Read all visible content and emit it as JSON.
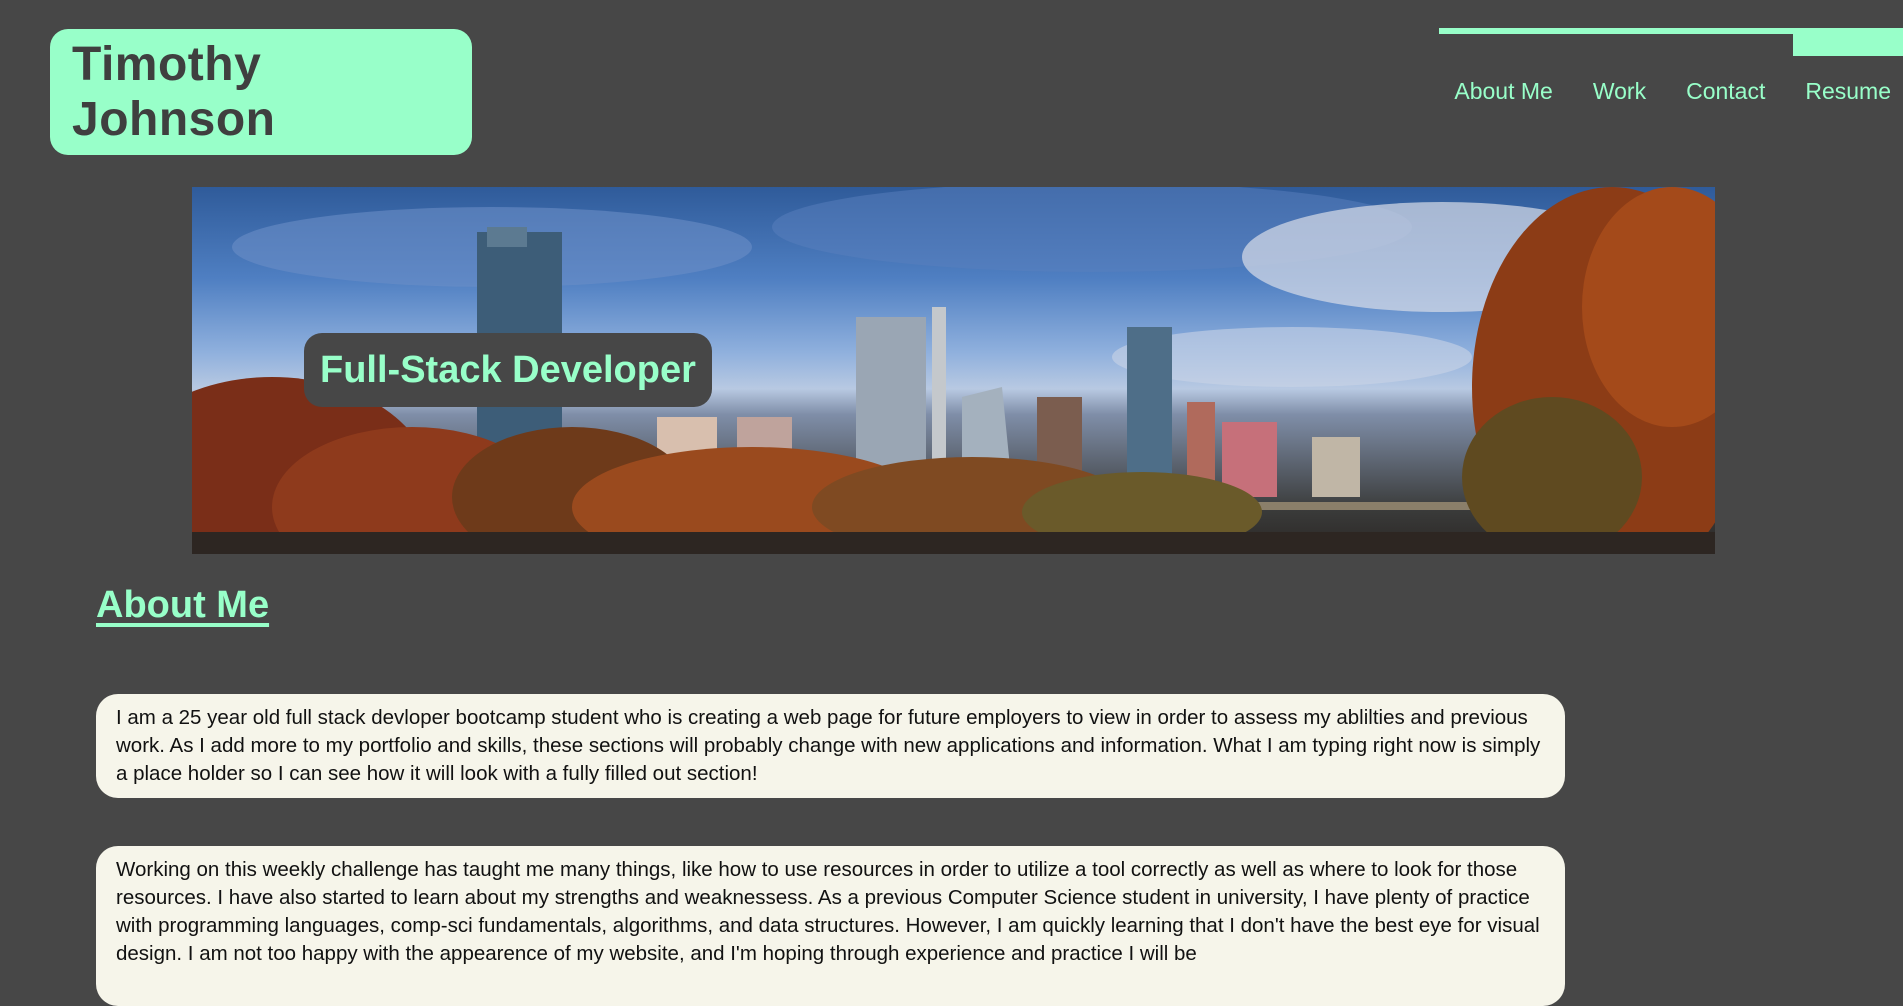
{
  "header": {
    "site_title": "Timothy Johnson"
  },
  "nav": {
    "items": [
      {
        "label": "About Me"
      },
      {
        "label": "Work"
      },
      {
        "label": "Contact"
      },
      {
        "label": "Resume"
      }
    ]
  },
  "hero": {
    "label": "Full-Stack Developer"
  },
  "about": {
    "heading": "About Me",
    "paragraphs": [
      "I am a 25 year old full stack devloper bootcamp student who is creating a web page for future employers to view in order to assess my ablilties and previous work. As I add more to my portfolio and skills, these sections will probably change with new applications and information. What I am typing right now is simply a place holder so I can see how it will look with a fully filled out section!",
      "Working on this weekly challenge has taught me many things, like how to use resources in order to utilize a tool correctly as well as where to look for those resources. I have also started to learn about my strengths and weaknessess. As a previous Computer Science student in university, I have plenty of practice with programming languages, comp-sci fundamentals, algorithms, and data structures. However, I am quickly learning that I don't have the best eye for visual design. I am not too happy with the appearence of my website, and I'm hoping through experience and practice I will be"
    ]
  },
  "colors": {
    "background": "#474747",
    "accent": "#98ffc9",
    "card": "#f6f5ea"
  }
}
